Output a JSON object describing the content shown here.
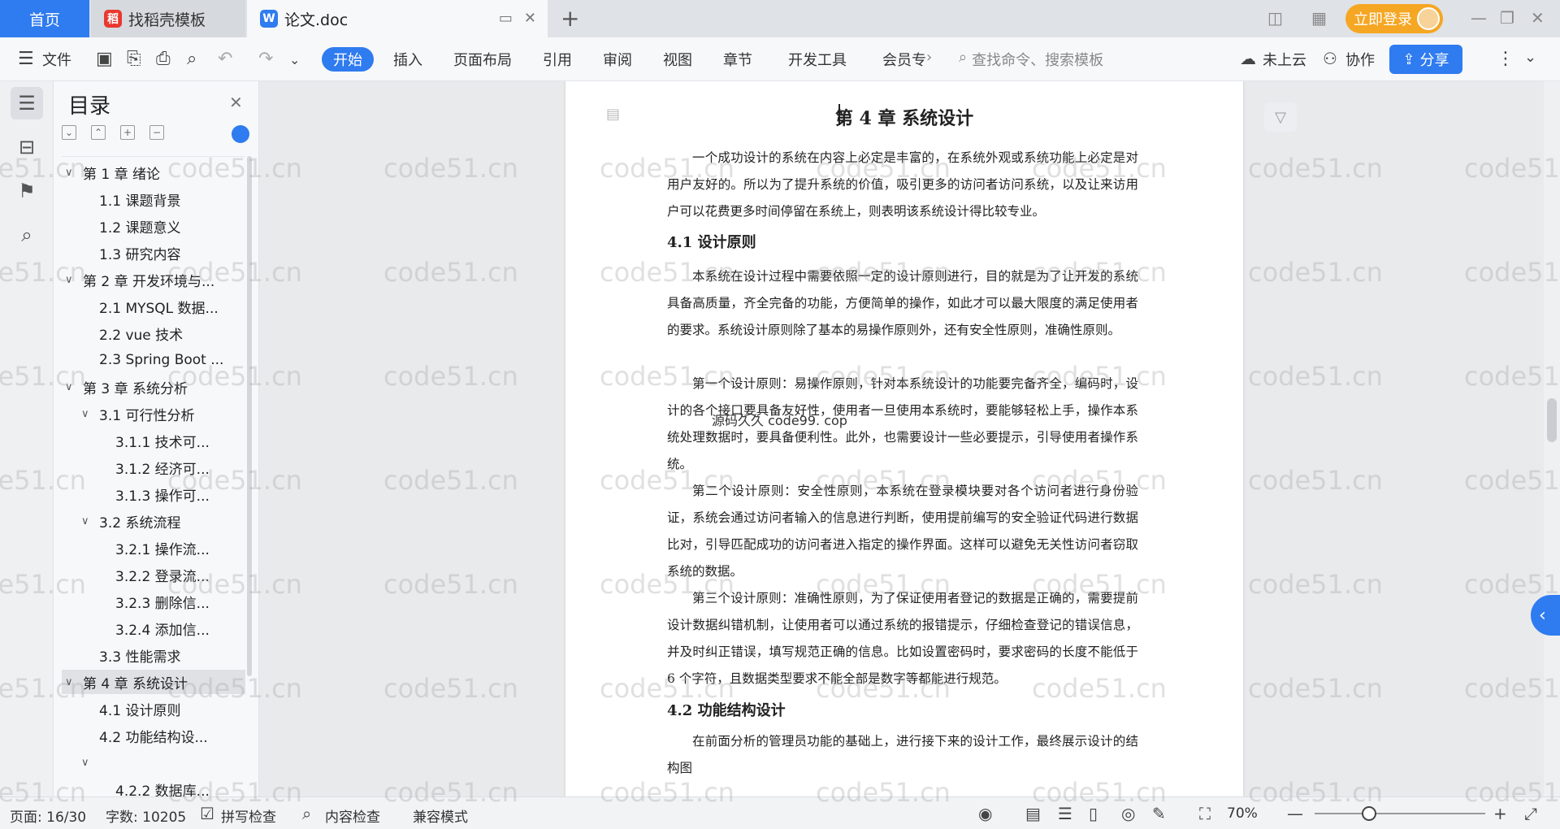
{
  "tabs": {
    "home": "首页",
    "template": "找稻壳模板",
    "document": "论文.doc"
  },
  "account": {
    "login_label": "立即登录"
  },
  "toolbar": {
    "file": "文件",
    "menus": [
      "开始",
      "插入",
      "页面布局",
      "引用",
      "审阅",
      "视图",
      "章节",
      "开发工具",
      "会员专"
    ],
    "search_placeholder": "查找命令、搜索模板",
    "cloud": "未上云",
    "collab": "协作",
    "share": "分享"
  },
  "toc": {
    "title": "目录",
    "items": [
      {
        "label": "第 1 章  绪论",
        "level": 1,
        "expanded": true
      },
      {
        "label": "1.1  课题背景",
        "level": 2
      },
      {
        "label": "1.2  课题意义",
        "level": 2
      },
      {
        "label": "1.3  研究内容",
        "level": 2
      },
      {
        "label": "第 2 章  开发环境与...",
        "level": 1,
        "expanded": true
      },
      {
        "label": "2.1 MYSQL 数据...",
        "level": 2
      },
      {
        "label": "2.2 vue 技术",
        "level": 2
      },
      {
        "label": "2.3 Spring Boot ...",
        "level": 2
      },
      {
        "label": "第 3 章  系统分析",
        "level": 1,
        "expanded": true
      },
      {
        "label": "3.1  可行性分析",
        "level": 2,
        "expanded": true
      },
      {
        "label": "3.1.1  技术可...",
        "level": 3
      },
      {
        "label": "3.1.2  经济可...",
        "level": 3
      },
      {
        "label": "3.1.3  操作可...",
        "level": 3
      },
      {
        "label": "3.2  系统流程",
        "level": 2,
        "expanded": true
      },
      {
        "label": "3.2.1  操作流...",
        "level": 3
      },
      {
        "label": "3.2.2  登录流...",
        "level": 3
      },
      {
        "label": "3.2.3  删除信...",
        "level": 3
      },
      {
        "label": "3.2.4  添加信...",
        "level": 3
      },
      {
        "label": "3.3  性能需求",
        "level": 2
      },
      {
        "label": "第 4 章  系统设计",
        "level": 1,
        "expanded": true,
        "active": true
      },
      {
        "label": "4.1  设计原则",
        "level": 2
      },
      {
        "label": "4.2  功能结构设...",
        "level": 2
      },
      {
        "label": "",
        "level": 2,
        "expanded": true
      },
      {
        "label": "4.2.2  数据库...",
        "level": 3
      }
    ]
  },
  "document": {
    "chapter_title": "第 4 章  系统设计",
    "intro": "一个成功设计的系统在内容上必定是丰富的，在系统外观或系统功能上必定是对用户友好的。所以为了提升系统的价值，吸引更多的访问者访问系统，以及让来访用户可以花费更多时间停留在系统上，则表明该系统设计得比较专业。",
    "s41_title": "4.1  设计原则",
    "s41_p1": "本系统在设计过程中需要依照一定的设计原则进行，目的就是为了让开发的系统具备高质量，齐全完备的功能，方便简单的操作，如此才可以最大限度的满足使用者的要求。系统设计原则除了基本的易操作原则外，还有安全性原则，准确性原则。",
    "s41_p2": "第一个设计原则：易操作原则，针对本系统设计的功能要完备齐全，编码时，设计的各个接口要具备友好性，使用者一旦使用本系统时，要能够轻松上手，操作本系统处理数据时，要具备便利性。此外，也需要设计一些必要提示，引导使用者操作系统。",
    "s41_p3": "第二个设计原则：安全性原则，本系统在登录模块要对各个访问者进行身份验证，系统会通过访问者输入的信息进行判断，使用提前编写的安全验证代码进行数据比对，引导匹配成功的访问者进入指定的操作界面。这样可以避免无关性访问者窃取系统的数据。",
    "s41_p4": "第三个设计原则：准确性原则，为了保证使用者登记的数据是正确的，需要提前设计数据纠错机制，让使用者可以通过系统的报错提示，仔细检查登记的错误信息，并及时纠正错误，填写规范正确的信息。比如设置密码时，要求密码的长度不能低于 6 个字符，且数据类型要求不能全部是数字等都能进行规范。",
    "s42_title": "4.2  功能结构设计",
    "s42_p1": "在前面分析的管理员功能的基础上，进行接下来的设计工作，最终展示设计的结构图",
    "overlay": "源码久久  code99. cop"
  },
  "watermark": "code51.cn",
  "status": {
    "page": "页面: 16/30",
    "words": "字数: 10205",
    "spell": "拼写检查",
    "content": "内容检查",
    "compat": "兼容模式",
    "zoom": "70%"
  }
}
